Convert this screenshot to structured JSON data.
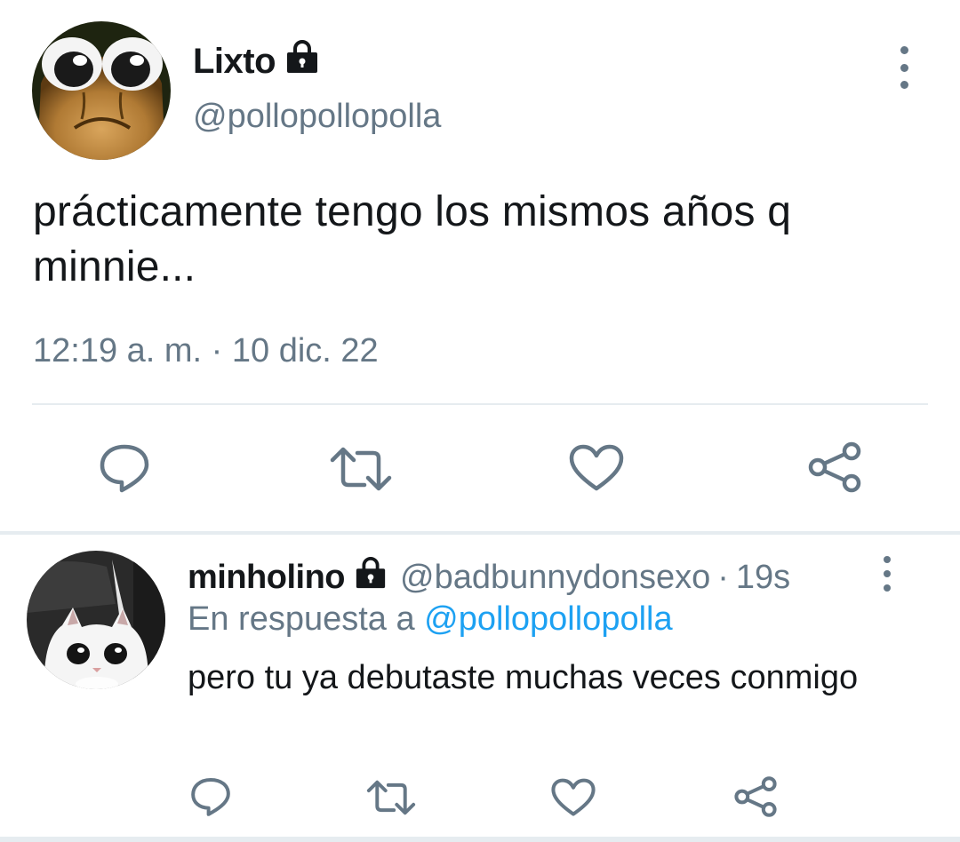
{
  "main_tweet": {
    "display_name": "Lixto",
    "handle": "@pollopollopolla",
    "text": "prácticamente tengo los mismos años q minnie...",
    "timestamp": "12:19 a. m. · 10 dic. 22",
    "avatar": "wide-eyed-frog-avatar",
    "badge_icon": "lock-icon"
  },
  "reply_tweet": {
    "display_name": "minholino",
    "handle": "@badbunnydonsexo",
    "separator": "·",
    "time": "19s",
    "replying_prefix": "En respuesta a",
    "replying_to": "@pollopollopolla",
    "text": "pero tu ya debutaste muchas veces conmigo",
    "avatar": "cat-avatar",
    "badge_icon": "lock-icon"
  },
  "actions": [
    "reply-icon",
    "retweet-icon",
    "like-icon",
    "share-icon"
  ],
  "colors": {
    "text_primary": "#14171a",
    "text_secondary": "#657786",
    "link": "#1da1f2",
    "divider": "#e6ecf0"
  }
}
